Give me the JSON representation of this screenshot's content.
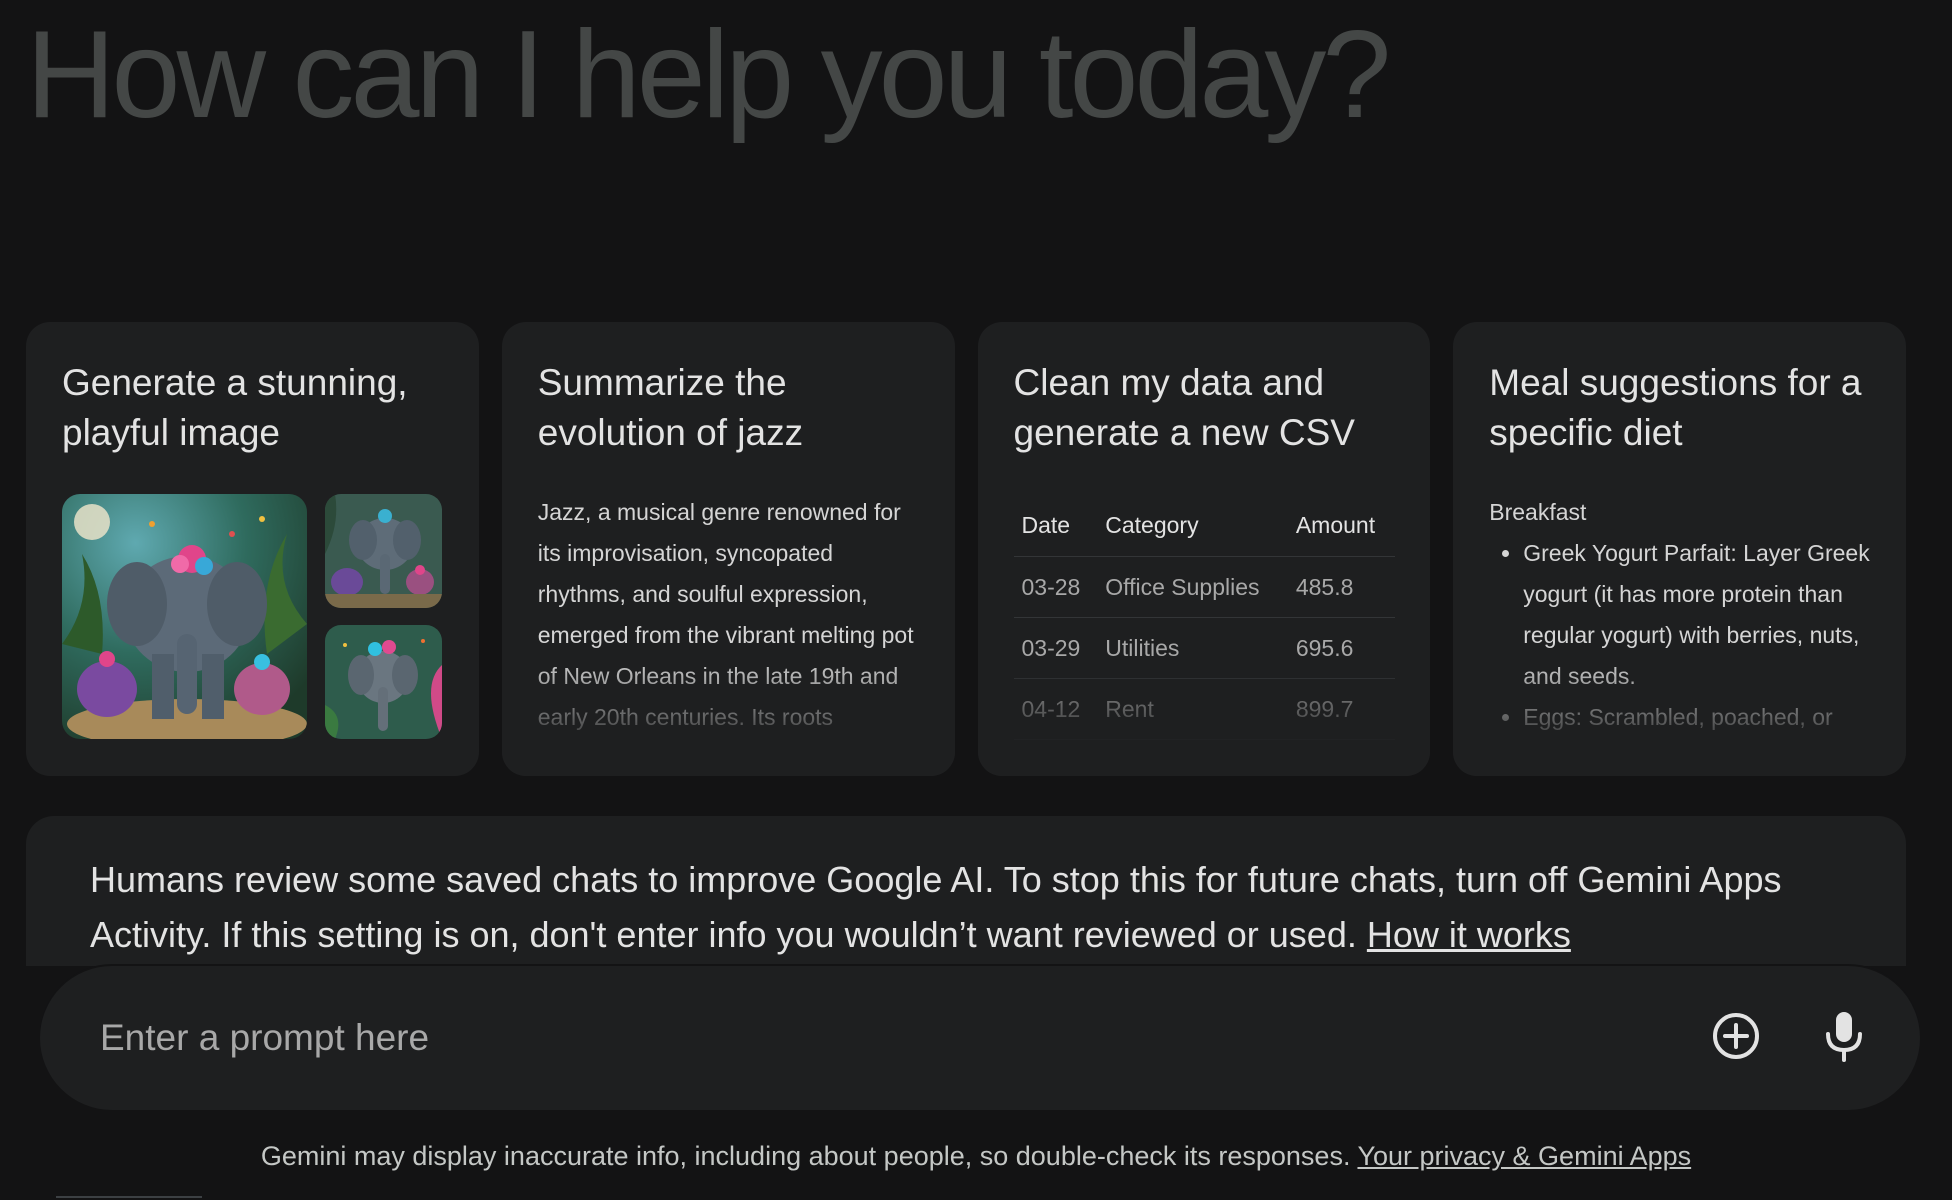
{
  "greeting": "How can I help you today?",
  "cards": [
    {
      "title": "Generate a stunning, playful image",
      "image_names": [
        "elephant-jungle-image",
        "elephant-family-image",
        "elephant-portrait-image"
      ]
    },
    {
      "title": "Summarize the evolution of jazz",
      "text": "Jazz, a musical genre renowned for its improvisation, syncopated rhythms, and soulful expression, emerged from the vibrant melting pot of New Orleans in the late 19th and early 20th centuries. Its roots"
    },
    {
      "title": "Clean my data and generate a new CSV",
      "table": {
        "headers": [
          "Date",
          "Category",
          "Amount"
        ],
        "rows": [
          [
            "03-28",
            "Office Supplies",
            "485.8"
          ],
          [
            "03-29",
            "Utilities",
            "695.6"
          ],
          [
            "04-12",
            "Rent",
            "899.7"
          ]
        ]
      }
    },
    {
      "title": "Meal suggestions for a specific diet",
      "heading": "Breakfast",
      "items": [
        "Greek Yogurt Parfait: Layer Greek yogurt (it has more protein than regular yogurt) with berries, nuts, and seeds.",
        "Eggs: Scrambled, poached, or"
      ]
    }
  ],
  "notice": {
    "text": "Humans review some saved chats to improve Google AI. To stop this for future chats, turn off Gemini Apps Activity. If this setting is on, don't enter info you wouldn’t want reviewed or used. ",
    "link": "How it works"
  },
  "prompt": {
    "placeholder": "Enter a prompt here",
    "value": ""
  },
  "icons": {
    "add": "add-circle-icon",
    "mic": "microphone-icon"
  },
  "disclaimer": {
    "text": "Gemini may display inaccurate info, including about people, so double-check its responses. ",
    "link": "Your privacy & Gemini Apps"
  }
}
